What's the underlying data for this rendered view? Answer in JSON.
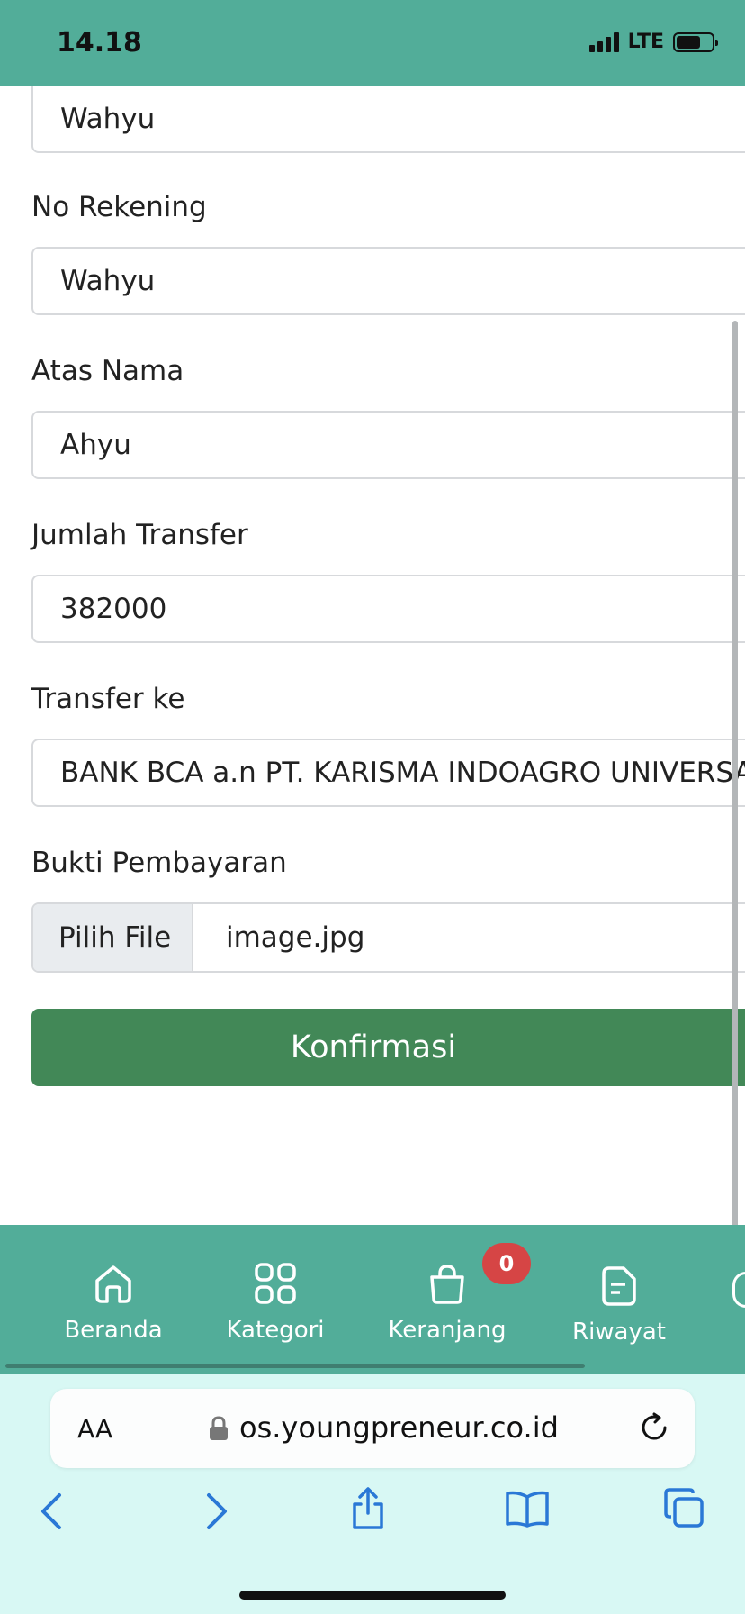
{
  "status": {
    "time": "14.18",
    "network": "LTE"
  },
  "form": {
    "top_value": "Wahyu",
    "fields": [
      {
        "label": "No Rekening",
        "value": "Wahyu"
      },
      {
        "label": "Atas Nama",
        "value": "Ahyu"
      },
      {
        "label": "Jumlah Transfer",
        "value": "382000"
      },
      {
        "label": "Transfer ke",
        "value": "BANK BCA a.n PT. KARISMA INDOAGRO UNIVERSA"
      }
    ],
    "proof": {
      "label": "Bukti Pembayaran",
      "button": "Pilih File",
      "file_name": "image.jpg"
    },
    "submit_label": "Konfirmasi"
  },
  "nav": {
    "items": [
      {
        "label": "Beranda",
        "icon": "home-icon"
      },
      {
        "label": "Kategori",
        "icon": "grid-icon"
      },
      {
        "label": "Keranjang",
        "icon": "bag-icon"
      },
      {
        "label": "Riwayat",
        "icon": "document-icon"
      }
    ],
    "cart_badge": "0"
  },
  "browser": {
    "aa_label": "AA",
    "url": "os.youngpreneur.co.id"
  },
  "colors": {
    "primary": "#52ad99",
    "button": "#428857",
    "badge": "#d64545",
    "browser_bg": "#d8f8f4"
  }
}
